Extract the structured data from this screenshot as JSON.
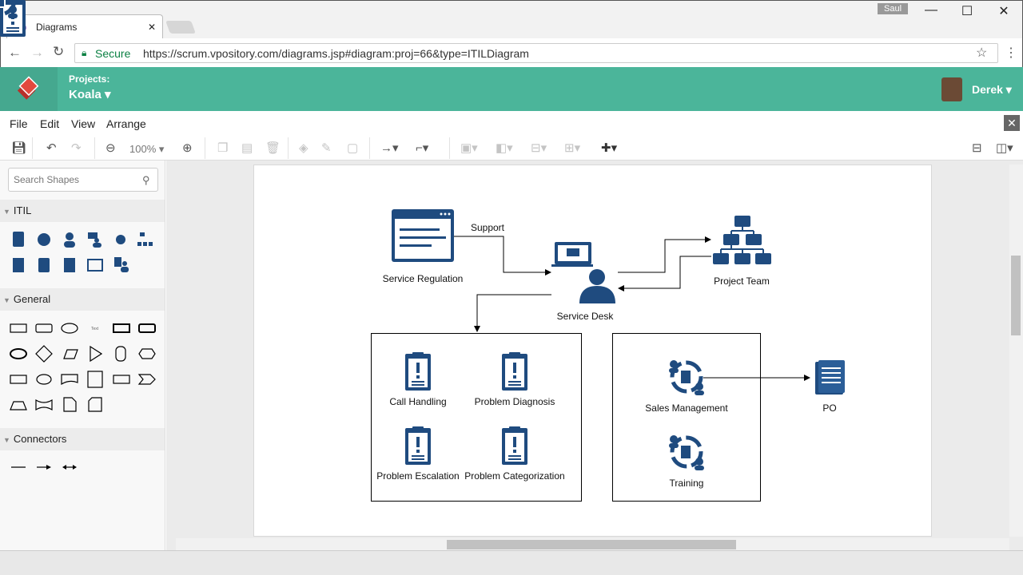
{
  "browser": {
    "tab_title": "Diagrams",
    "user": "Saul",
    "secure_label": "Secure",
    "url": "https://scrum.vpository.com/diagrams.jsp#diagram:proj=66&type=ITILDiagram"
  },
  "header": {
    "projects_label": "Projects:",
    "project": "Koala",
    "username": "Derek",
    "color": "#4bb59a"
  },
  "menu": [
    "File",
    "Edit",
    "View",
    "Arrange"
  ],
  "toolbar": {
    "zoom": "100%"
  },
  "sidebar": {
    "search_placeholder": "Search Shapes",
    "sections": [
      "ITIL",
      "General",
      "Connectors"
    ]
  },
  "diagram": {
    "icon_color": "#1f4b7f",
    "nodes": {
      "service_regulation": "Service Regulation",
      "service_desk": "Service Desk",
      "project_team": "Project Team",
      "call_handling": "Call Handling",
      "problem_diagnosis": "Problem Diagnosis",
      "problem_escalation": "Problem Escalation",
      "problem_categorization": "Problem Categorization",
      "sales_management": "Sales Management",
      "training": "Training",
      "po": "PO"
    },
    "edge_labels": {
      "support": "Support"
    }
  }
}
